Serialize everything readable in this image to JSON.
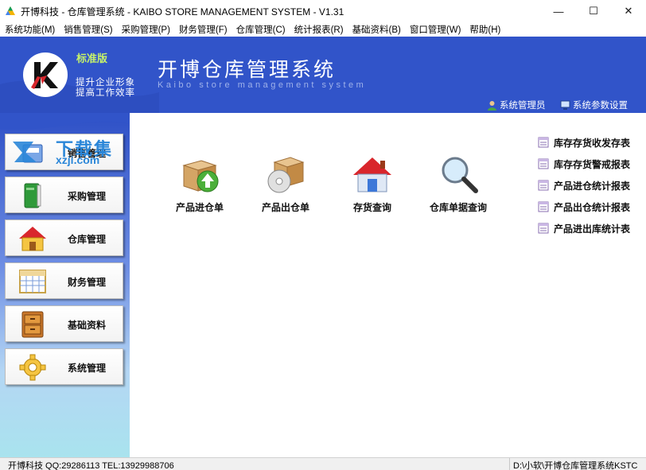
{
  "window": {
    "title": "开博科技 - 仓库管理系统 - KAIBO STORE MANAGEMENT SYSTEM - V1.31",
    "minimize_glyph": "—",
    "maximize_glyph": "☐",
    "close_glyph": "✕"
  },
  "menubar": {
    "items": [
      {
        "label": "系统功能(M)"
      },
      {
        "label": "销售管理(S)"
      },
      {
        "label": "采购管理(P)"
      },
      {
        "label": "财务管理(F)"
      },
      {
        "label": "仓库管理(C)"
      },
      {
        "label": "统计报表(R)"
      },
      {
        "label": "基础资料(B)"
      },
      {
        "label": "窗口管理(W)"
      },
      {
        "label": "帮助(H)"
      }
    ]
  },
  "header": {
    "edition": "标准版",
    "slogan_line1": "提升企业形象",
    "slogan_line2": "提高工作效率",
    "system_title": "开博仓库管理系统",
    "system_subtitle": "Kaibo store management system",
    "admin_link": "系统管理员",
    "settings_link": "系统参数设置"
  },
  "sidebar": {
    "items": [
      {
        "label": "销售管理",
        "icon": "sales-icon"
      },
      {
        "label": "采购管理",
        "icon": "purchase-book-icon"
      },
      {
        "label": "仓库管理",
        "icon": "warehouse-house-icon"
      },
      {
        "label": "财务管理",
        "icon": "finance-calendar-icon"
      },
      {
        "label": "基础资料",
        "icon": "cabinet-icon"
      },
      {
        "label": "系统管理",
        "icon": "gear-icon"
      }
    ]
  },
  "watermark": {
    "cn": "下载集",
    "url": "xzji.com"
  },
  "main": {
    "functions": [
      {
        "label": "产品进仓单",
        "icon": "box-inbound-icon"
      },
      {
        "label": "产品出仓单",
        "icon": "box-disc-icon"
      },
      {
        "label": "存货查询",
        "icon": "house-icon"
      },
      {
        "label": "仓库单据查询",
        "icon": "magnifier-icon"
      }
    ],
    "reports": [
      {
        "label": "库存存货收发存表"
      },
      {
        "label": "库存存货警戒报表"
      },
      {
        "label": "产品进仓统计报表"
      },
      {
        "label": "产品出仓统计报表"
      },
      {
        "label": "产品进出库统计表"
      }
    ]
  },
  "statusbar": {
    "left": "开博科技 QQ:29286113 TEL:13929988706",
    "right": "D:\\小软\\开博仓库管理系统KSTC"
  },
  "colors": {
    "banner_blue": "#3154c9",
    "edition_green": "#c6f26a",
    "watermark_blue": "#2a86d8"
  }
}
